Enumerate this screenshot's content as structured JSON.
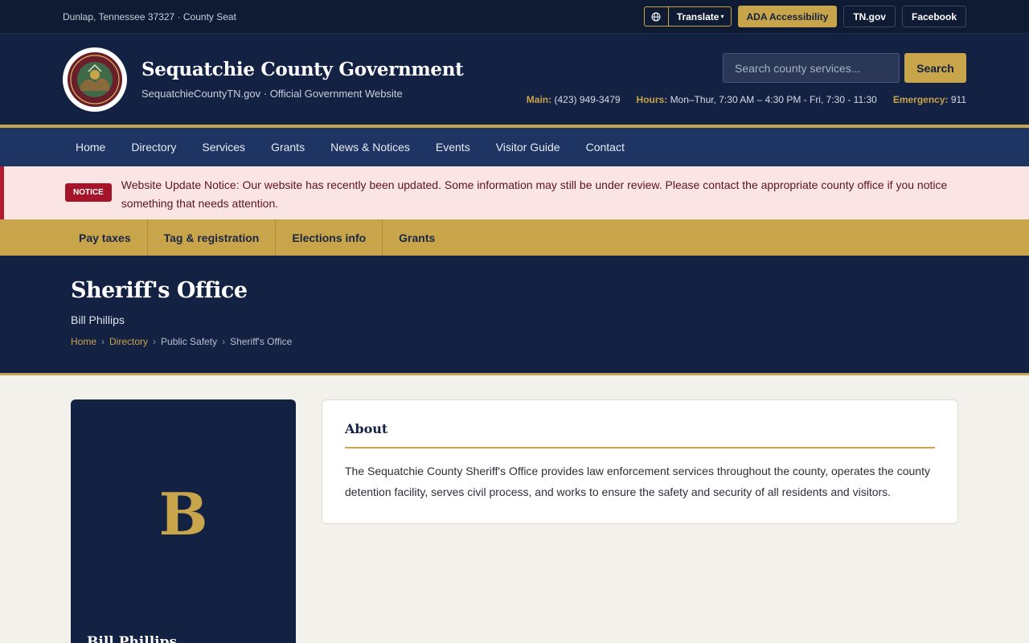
{
  "utility": {
    "location": "Dunlap, Tennessee 37327 · County Seat",
    "translate_label": "Translate",
    "links": [
      "ADA Accessibility",
      "TN.gov",
      "Facebook"
    ]
  },
  "header": {
    "title": "Sequatchie County Government",
    "subtitle": "SequatchieCountyTN.gov · Official Government Website",
    "search_placeholder": "Search county services...",
    "search_button": "Search",
    "contact": {
      "main_label": "Main:",
      "main_value": "(423) 949-3479",
      "hours_label": "Hours:",
      "hours_value": "Mon–Thur, 7:30 AM – 4:30 PM - Fri, 7:30 - 11:30",
      "emergency_label": "Emergency:",
      "emergency_value": "911"
    }
  },
  "nav": [
    "Home",
    "Directory",
    "Services",
    "Grants",
    "News & Notices",
    "Events",
    "Visitor Guide",
    "Contact"
  ],
  "notice": {
    "tag": "NOTICE",
    "message": "Website Update Notice: Our website has recently been updated. Some information may still be under review. Please contact the appropriate county office if you notice something that needs attention."
  },
  "quick_links": [
    "Pay taxes",
    "Tag & registration",
    "Elections info",
    "Grants"
  ],
  "hero": {
    "title": "Sheriff's Office",
    "person": "Bill Phillips",
    "breadcrumb": [
      "Home",
      "Directory",
      "Public Safety",
      "Sheriff's Office"
    ]
  },
  "profile": {
    "initial": "B",
    "name": "Bill Phillips"
  },
  "about": {
    "heading": "About",
    "text": "The Sequatchie County Sheriff's Office provides law enforcement services throughout the county, operates the county detention facility, serves civil process, and works to ensure the safety and security of all residents and visitors."
  },
  "colors": {
    "navy": "#132143",
    "gold": "#c8a44a",
    "nav_blue": "#1e3463",
    "notice_bg": "#fbe4e4",
    "notice_red": "#a5152a"
  }
}
